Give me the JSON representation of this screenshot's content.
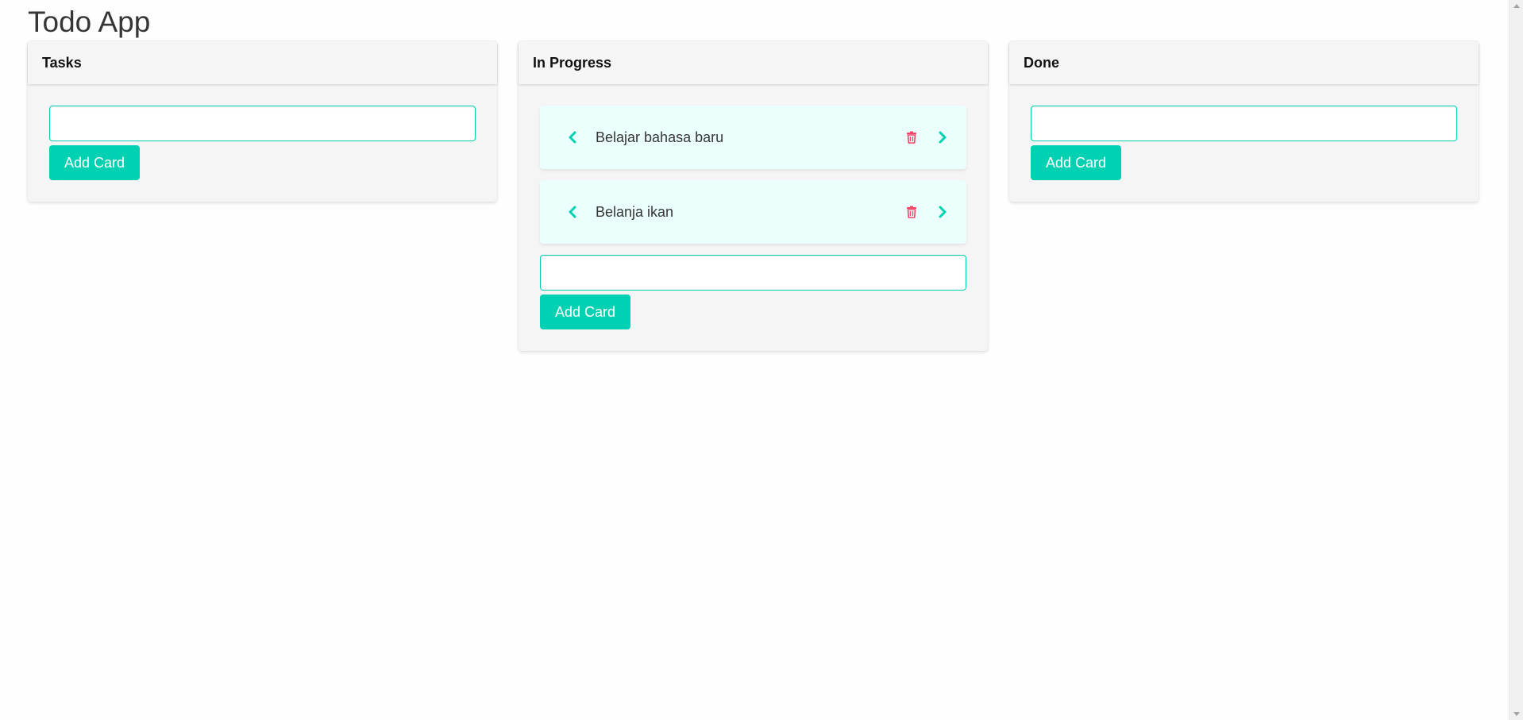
{
  "app": {
    "title": "Todo App"
  },
  "colors": {
    "accent": "#00d1b2",
    "danger": "#f14668",
    "card_background": "#ebfffc",
    "column_background": "#f5f5f5"
  },
  "columns": [
    {
      "title": "Tasks",
      "cards": [],
      "input_value": "",
      "add_label": "Add Card"
    },
    {
      "title": "In Progress",
      "cards": [
        {
          "title": "Belajar bahasa baru",
          "icons": [
            "chevron-left-icon",
            "trash-icon",
            "chevron-right-icon"
          ]
        },
        {
          "title": "Belanja ikan",
          "icons": [
            "chevron-left-icon",
            "trash-icon",
            "chevron-right-icon"
          ]
        }
      ],
      "input_value": "",
      "add_label": "Add Card"
    },
    {
      "title": "Done",
      "cards": [],
      "input_value": "",
      "add_label": "Add Card"
    }
  ]
}
